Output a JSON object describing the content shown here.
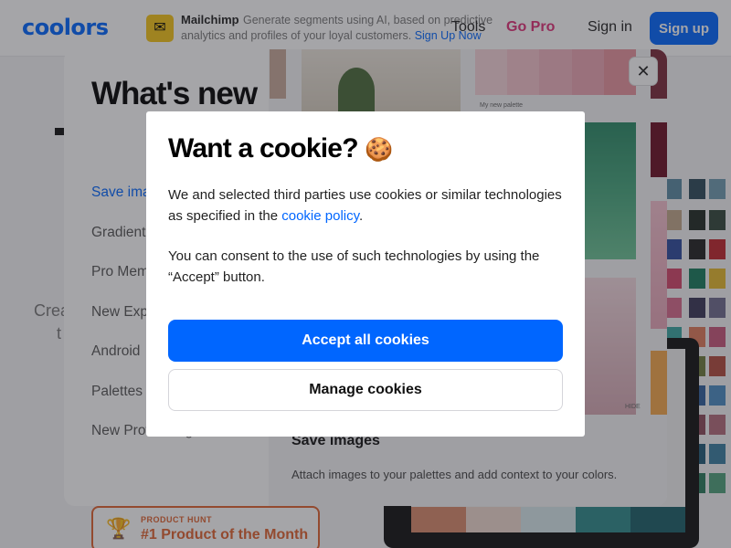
{
  "header": {
    "logo": "coolors",
    "ad": {
      "brand": "Mailchimp",
      "text": "Generate segments using AI, based on predictive analytics and profiles of your loyal customers.",
      "link": "Sign Up Now"
    },
    "nav": {
      "tools": "Tools",
      "gopro": "Go Pro",
      "signin": "Sign in",
      "signup": "Sign up"
    }
  },
  "background": {
    "text1": "Crea",
    "text2": "t",
    "product_hunt": {
      "label": "PRODUCT HUNT",
      "title": "#1 Product of the Month"
    }
  },
  "whats_new": {
    "title": "What's new",
    "items": [
      {
        "label": "Save images",
        "active": true
      },
      {
        "label": "Gradient",
        "active": false
      },
      {
        "label": "Pro Mem",
        "active": false
      },
      {
        "label": "New Exp",
        "active": false
      },
      {
        "label": "Android",
        "active": false
      },
      {
        "label": "Palettes",
        "active": false
      },
      {
        "label": "New Profile Page",
        "active": false
      }
    ],
    "palette_label": "My new palette",
    "hide_label": "HIDE",
    "feature_title": "Save images",
    "feature_desc": "Attach images to your palettes and add context to your colors.",
    "close_icon": "close-icon"
  },
  "cookie": {
    "title": "Want a cookie?",
    "emoji": "🍪",
    "p1_before": "We and selected third parties use cookies or similar technologies as specified in the ",
    "p1_link": "cookie policy",
    "p1_after": ".",
    "p2": "You can consent to the use of such technologies by using the “Accept” button.",
    "accept": "Accept all cookies",
    "manage": "Manage cookies"
  },
  "colors": {
    "brand": "#0066ff",
    "gopro": "#e03178",
    "producthunt": "#e06230"
  }
}
